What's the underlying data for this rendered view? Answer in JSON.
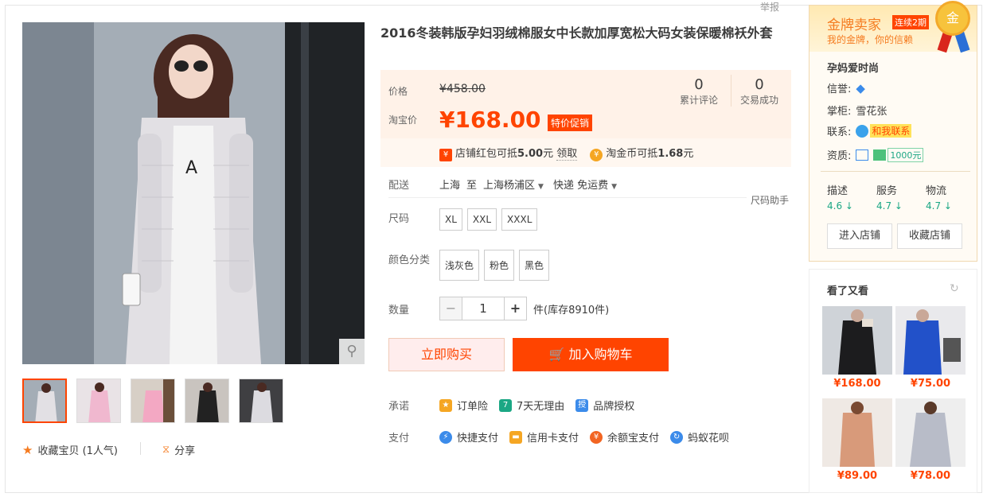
{
  "report": "举报",
  "product": {
    "title": "2016冬装韩版孕妇羽绒棉服女中长款加厚宽松大码女装保暖棉袄外套",
    "price_label": "价格",
    "original_price": "¥458.00",
    "tb_price_label": "淘宝价",
    "current_price": "¥168.00",
    "promo_badge": "特价促销",
    "reviews_count": "0",
    "reviews_label": "累计评论",
    "deals_count": "0",
    "deals_label": "交易成功",
    "coupon_icon": "red-envelope-icon",
    "coupon_text_pre": "店铺红包可抵",
    "coupon_amount": "5.00",
    "coupon_unit": "元",
    "coupon_claim": "领取",
    "coin_text_pre": "淘金币可抵",
    "coin_amount": "1.68",
    "coin_unit": "元",
    "delivery_label": "配送",
    "delivery_from": "上海",
    "delivery_to_word": "至",
    "delivery_to": "上海杨浦区",
    "shipping": "快递 免运费",
    "size_helper": "尺码助手",
    "size_label": "尺码",
    "sizes": [
      "XL",
      "XXL",
      "XXXL"
    ],
    "color_label": "颜色分类",
    "colors": [
      "浅灰色",
      "粉色",
      "黑色"
    ],
    "qty_label": "数量",
    "qty_minus": "−",
    "qty_value": "1",
    "qty_plus": "+",
    "stock_text": "件(库存8910件)",
    "buy_now": "立即购买",
    "add_cart": "加入购物车",
    "promise_label": "承诺",
    "promises": [
      "订单险",
      "7天无理由",
      "品牌授权"
    ],
    "pay_label": "支付",
    "payments": [
      "快捷支付",
      "信用卡支付",
      "余额宝支付",
      "蚂蚁花呗"
    ]
  },
  "gallery": {
    "favorite": "收藏宝贝 (1人气)",
    "share": "分享",
    "zoom_icon": "magnifier-icon"
  },
  "seller": {
    "gold_title": "金牌卖家",
    "streak": "连续2期",
    "gold_sub": "我的金牌，你的信赖",
    "medal": "金",
    "shop_name": "孕妈爱时尚",
    "credit_label": "信誉:",
    "keeper_label": "掌柜:",
    "keeper": "雪花张",
    "contact_label": "联系:",
    "contact": "和我联系",
    "qual_label": "资质:",
    "deposit": "1000元",
    "ratings": [
      {
        "name": "描述",
        "score": "4.6"
      },
      {
        "name": "服务",
        "score": "4.7"
      },
      {
        "name": "物流",
        "score": "4.7"
      }
    ],
    "enter_shop": "进入店铺",
    "fav_shop": "收藏店铺"
  },
  "also_viewed": {
    "title": "看了又看",
    "items": [
      {
        "price": "¥168.00"
      },
      {
        "price": "¥75.00"
      },
      {
        "price": "¥89.00"
      },
      {
        "price": "¥78.00"
      }
    ]
  }
}
